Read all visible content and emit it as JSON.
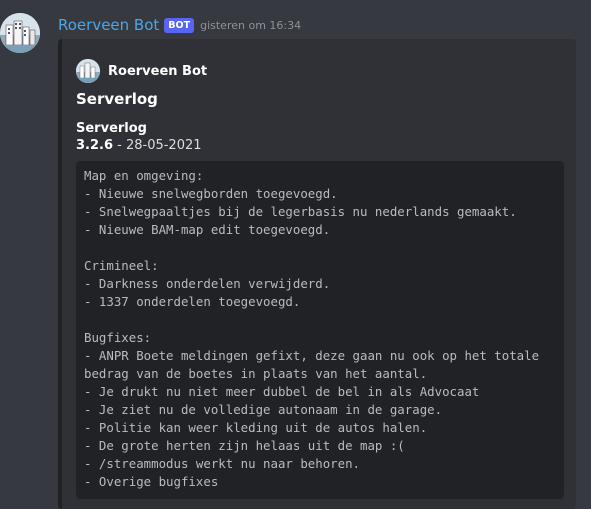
{
  "message": {
    "username": "Roerveen Bot",
    "bot_tag": "BOT",
    "timestamp": "gisteren om 16:34"
  },
  "embed": {
    "author": "Roerveen Bot",
    "title": "Serverlog",
    "field_name": "Serverlog",
    "version": "3.2.6",
    "version_rest": " - 28-05-2021",
    "code_lines": [
      "Map en omgeving:",
      "- Nieuwe snelwegborden toegevoegd.",
      "- Snelwegpaaltjes bij de legerbasis nu nederlands gemaakt.",
      "- Nieuwe BAM-map edit toegevoegd.",
      "",
      "Crimineel:",
      "- Darkness onderdelen verwijderd.",
      "- 1337 onderdelen toegevoegd.",
      "",
      "Bugfixes:",
      "- ANPR Boete meldingen gefixt, deze gaan nu ook op het totale",
      "bedrag van de boetes in plaats van het aantal.",
      "- Je drukt nu niet meer dubbel de bel in als Advocaat",
      "- Je ziet nu de volledige autonaam in de garage.",
      "- Politie kan weer kleding uit de autos halen.",
      "- De grote herten zijn helaas uit de map :(",
      "- /streammodus werkt nu naar behoren.",
      "- Overige bugfixes"
    ]
  },
  "colors": {
    "background": "#36393f",
    "embed_bg": "#2f3136",
    "username": "#4ea5e6",
    "bot_tag": "#5865f2"
  },
  "icons": {
    "avatar": "city-skyline-avatar-icon",
    "author_icon": "city-skyline-avatar-icon"
  }
}
